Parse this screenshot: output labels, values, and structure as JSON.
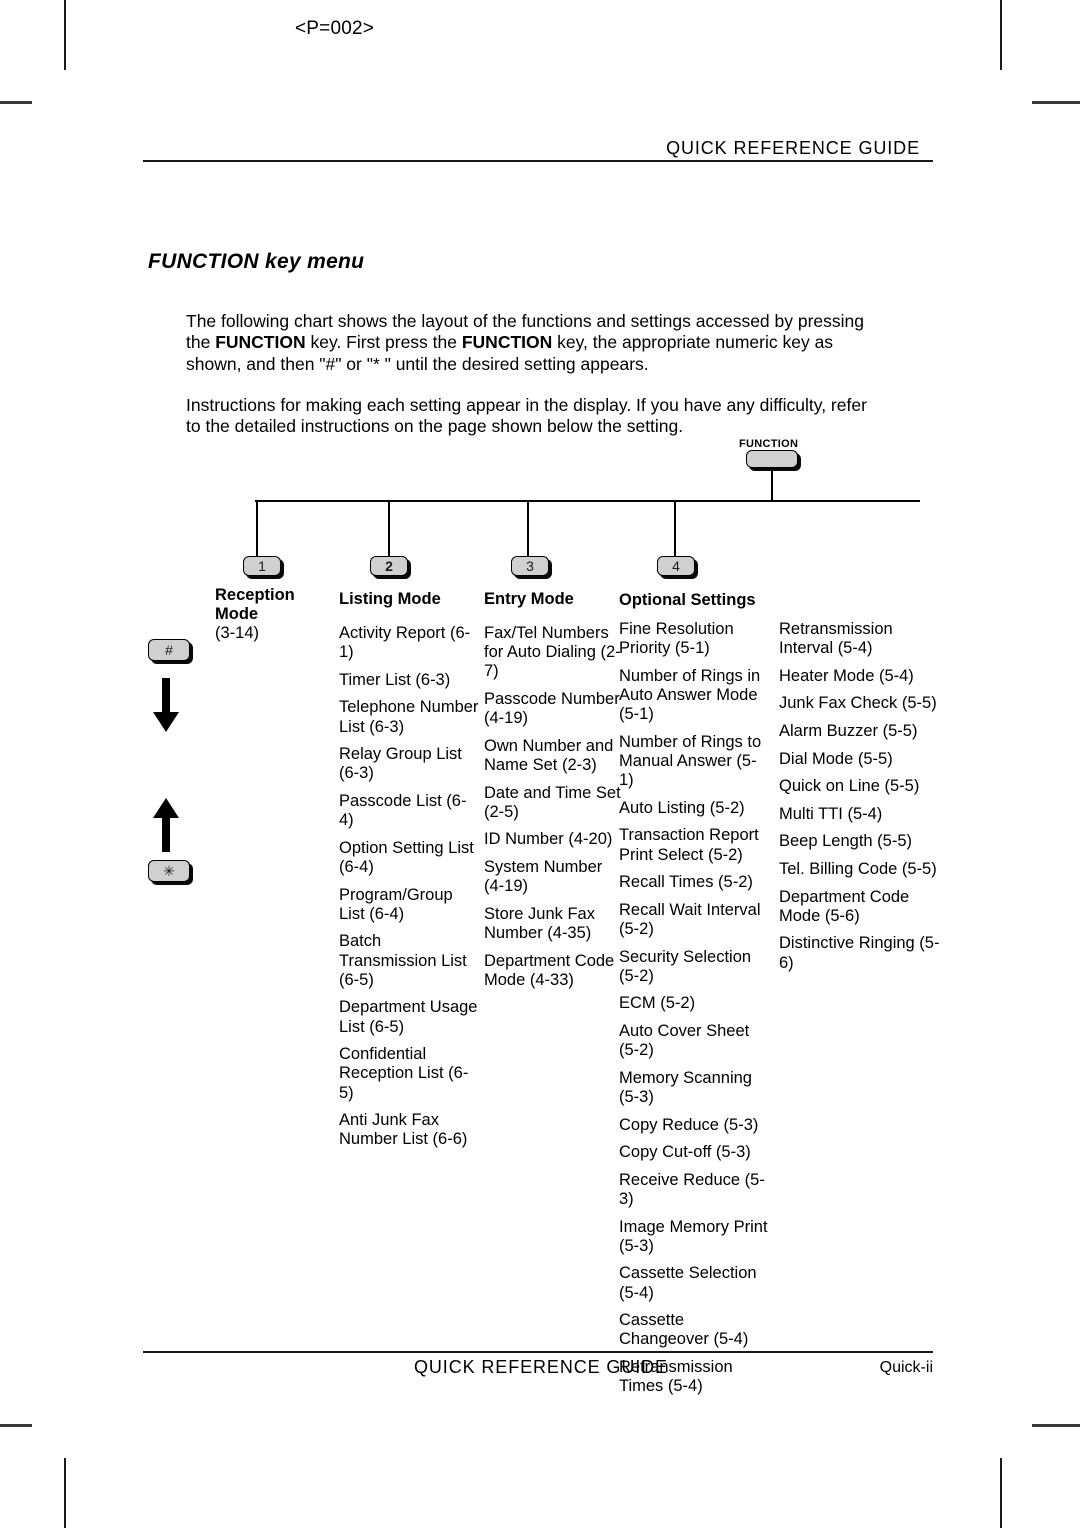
{
  "page_marker": "<P=002>",
  "header": {
    "title": "QUICK REFERENCE GUIDE"
  },
  "section": {
    "title": "FUNCTION key menu",
    "paragraph_1_part1": "The following chart shows the layout of the functions and settings accessed by pressing the ",
    "paragraph_1_bold1": "FUNCTION",
    "paragraph_1_part2": " key. First press the ",
    "paragraph_1_bold2": "FUNCTION",
    "paragraph_1_part3": " key, the appropriate numeric key as shown, and then \"#\" or \"*  \" until the desired setting appears.",
    "paragraph_2": "Instructions for making each setting appear in the display. If you have any difficulty, refer to the detailed instructions on the page shown below the setting."
  },
  "diagram": {
    "function_key_label": "FUNCTION",
    "function_key_face": "",
    "hash_key": "#",
    "star_key": "✳",
    "keys": [
      {
        "number": "1",
        "bold": false
      },
      {
        "number": "2",
        "bold": true
      },
      {
        "number": "3",
        "bold": false
      },
      {
        "number": "4",
        "bold": false
      }
    ],
    "columns": [
      {
        "header": "Reception Mode",
        "items": [
          "(3-14)"
        ]
      },
      {
        "header": "Listing Mode",
        "items": [
          "Activity Report (6-1)",
          "Timer List (6-3)",
          "Telephone Number List (6-3)",
          "Relay Group List (6-3)",
          "Passcode List (6-4)",
          "Option Setting List (6-4)",
          "Program/Group List (6-4)",
          "Batch Transmission List (6-5)",
          "Department Usage List (6-5)",
          "Confidential Reception List (6-5)",
          "Anti Junk Fax Number List (6-6)"
        ]
      },
      {
        "header": "Entry Mode",
        "items": [
          "Fax/Tel Numbers for Auto Dialing (2-7)",
          "Passcode Number (4-19)",
          "Own Number and Name Set (2-3)",
          "Date and Time Set (2-5)",
          "ID Number (4-20)",
          "System Number (4-19)",
          "Store Junk Fax Number (4-35)",
          "Department Code Mode (4-33)"
        ]
      },
      {
        "header": "Optional Settings",
        "items": [
          "Fine Resolution Priority (5-1)",
          "Number of Rings in Auto Answer Mode (5-1)",
          "Number of Rings to Manual Answer (5-1)",
          "Auto Listing (5-2)",
          "Transaction Report Print Select (5-2)",
          "Recall Times (5-2)",
          "Recall Wait Interval (5-2)",
          "Security Selection (5-2)",
          "ECM (5-2)",
          "Auto Cover Sheet (5-2)",
          "Memory Scanning (5-3)",
          "Copy Reduce (5-3)",
          "Copy Cut-off (5-3)",
          "Receive Reduce (5-3)",
          "Image Memory Print (5-3)",
          "Cassette Selection (5-4)",
          "Cassette Changeover (5-4)",
          "Retransmission Times (5-4)"
        ],
        "items_continued": [
          "Retransmission Interval (5-4)",
          "Heater Mode (5-4)",
          "Junk Fax Check (5-5)",
          "Alarm Buzzer (5-5)",
          "Dial Mode (5-5)",
          "Quick on Line (5-5)",
          "Multi TTI (5-4)",
          "Beep Length (5-5)",
          "Tel. Billing Code (5-5)",
          "Department Code Mode (5-6)",
          "Distinctive Ringing (5-6)"
        ]
      }
    ]
  },
  "footer": {
    "center": "QUICK REFERENCE GUIDE",
    "page": "Quick-ii"
  }
}
